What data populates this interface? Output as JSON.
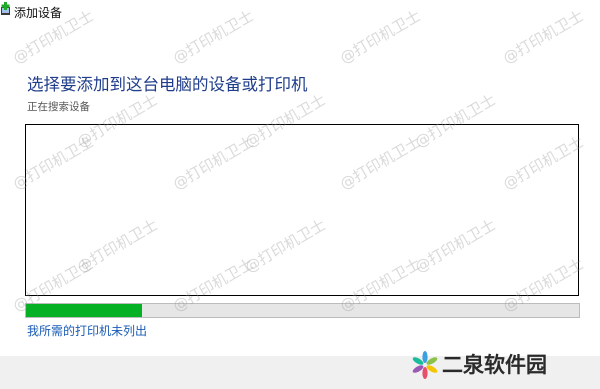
{
  "window": {
    "title": "添加设备"
  },
  "main": {
    "heading": "选择要添加到这台电脑的设备或打印机",
    "status": "正在搜索设备",
    "progress": 0.21,
    "link": "我所需的打印机未列出"
  },
  "watermark": {
    "text": "@打印机卫士"
  },
  "logo": {
    "text": "二泉软件园"
  },
  "colors": {
    "heading": "#1f3d8a",
    "link": "#1a5bb5",
    "progress_fill": "#06b025"
  }
}
